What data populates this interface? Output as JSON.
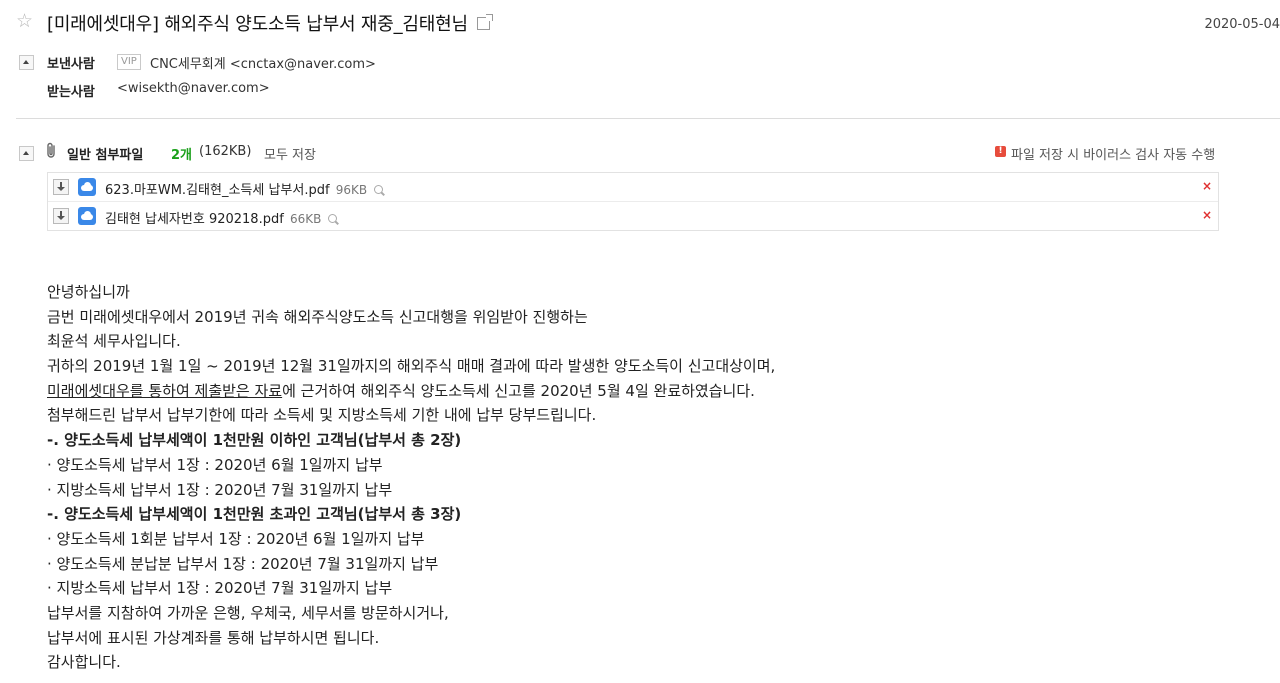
{
  "subject": "[미래에셋대우] 해외주식 양도소득 납부서 재중_김태현님",
  "date": "2020-05-04",
  "from": {
    "label": "보낸사람",
    "vip": "VIP",
    "value": "CNC세무회계 <cnctax@naver.com>"
  },
  "to": {
    "label": "받는사람",
    "value": "<wisekth@naver.com>"
  },
  "attachments": {
    "label": "일반 첨부파일",
    "count": "2개",
    "total_size": "(162KB)",
    "save_all": "모두 저장",
    "scan_notice": "파일 저장 시 바이러스 검사 자동 수행",
    "files": [
      {
        "name": "623.마포WM.김태현_소득세 납부서.pdf",
        "size": "96KB"
      },
      {
        "name": "김태현 납세자번호 920218.pdf",
        "size": "66KB"
      }
    ]
  },
  "body": {
    "lines": [
      "안녕하십니까",
      "금번 미래에셋대우에서 2019년 귀속 해외주식양도소득 신고대행을 위임받아 진행하는",
      "최윤석 세무사입니다.",
      "귀하의 2019년 1월 1일 ~ 2019년 12월 31일까지의 해외주식 매매 결과에 따라 발생한 양도소득이 신고대상이며,",
      "미래에셋대우를 통하여 제출받은 자료",
      "에 근거하여 해외주식 양도소득세 신고를 2020년 5월 4일 완료하였습니다.",
      "첨부해드린 납부서 납부기한에 따라 소득세 및 지방소득세 기한 내에 납부 당부드립니다.",
      "-. 양도소득세 납부세액이 1천만원 이하인 고객님(납부서 총 2장)",
      "· 양도소득세 납부서 1장 : 2020년 6월 1일까지 납부",
      "· 지방소득세 납부서 1장 : 2020년 7월 31일까지 납부",
      "-. 양도소득세 납부세액이 1천만원 초과인 고객님(납부서 총 3장)",
      "· 양도소득세 1회분 납부서 1장 : 2020년 6월 1일까지 납부",
      "· 양도소득세 분납분 납부서 1장 : 2020년 7월 31일까지 납부",
      "· 지방소득세 납부서 1장 : 2020년 7월 31일까지 납부",
      "납부서를 지참하여 가까운 은행, 우체국, 세무서를 방문하시거나,",
      "납부서에 표시된 가상계좌를 통해 납부하시면 됩니다.",
      "감사합니다."
    ]
  },
  "icons": {
    "star": "star-icon",
    "clip": "paperclip-icon",
    "download": "download-icon",
    "cloud": "cloud-save-icon",
    "delete": "close-icon",
    "preview": "search-icon"
  },
  "colors": {
    "count_green": "#1aa01a",
    "cloud_blue": "#3a88e8",
    "delete_red": "#e03030"
  }
}
